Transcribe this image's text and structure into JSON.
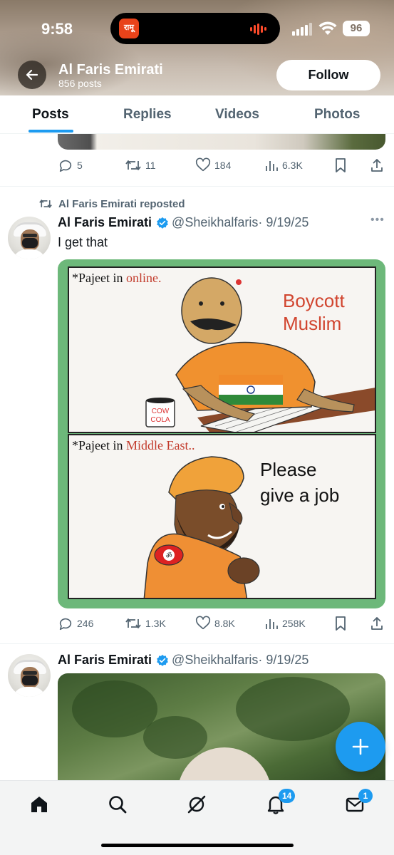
{
  "status_bar": {
    "time": "9:58",
    "battery": "96",
    "island_app_label": "रामू"
  },
  "header": {
    "profile_name": "Al Faris Emirati",
    "post_count": "856 posts",
    "follow_label": "Follow"
  },
  "tabs": [
    {
      "label": "Posts",
      "active": true
    },
    {
      "label": "Replies",
      "active": false
    },
    {
      "label": "Videos",
      "active": false
    },
    {
      "label": "Photos",
      "active": false
    }
  ],
  "prev_post": {
    "actions": {
      "replies": "5",
      "reposts": "11",
      "likes": "184",
      "views": "6.3K"
    }
  },
  "post1": {
    "repost_label": "Al Faris Emirati reposted",
    "author": "Al Faris Emirati",
    "handle": "@Sheikhalfaris",
    "date": "· 9/19/25",
    "text": "I get that",
    "meme": {
      "top_caption_prefix": "*Pajeet in ",
      "top_caption_highlight": "online.",
      "top_bubble_line1": "Boycott",
      "top_bubble_line2": "Muslim",
      "mug_text_1": "COW",
      "mug_text_2": "COLA",
      "bottom_caption_prefix": "*Pajeet in ",
      "bottom_caption_highlight": "Middle East..",
      "bottom_bubble_line1": "Please",
      "bottom_bubble_line2": "give a job"
    },
    "actions": {
      "replies": "246",
      "reposts": "1.3K",
      "likes": "8.8K",
      "views": "258K"
    }
  },
  "post2": {
    "author": "Al Faris Emirati",
    "handle": "@Sheikhalfaris",
    "date": "· 9/19/25"
  },
  "bottom_nav": {
    "items": [
      "home-icon",
      "search-icon",
      "grok-icon",
      "notifications-icon",
      "messages-icon"
    ],
    "notifications_badge": "14",
    "messages_badge": "1"
  },
  "colors": {
    "accent": "#1d9bf0",
    "text": "#0f1419",
    "muted": "#536471"
  }
}
